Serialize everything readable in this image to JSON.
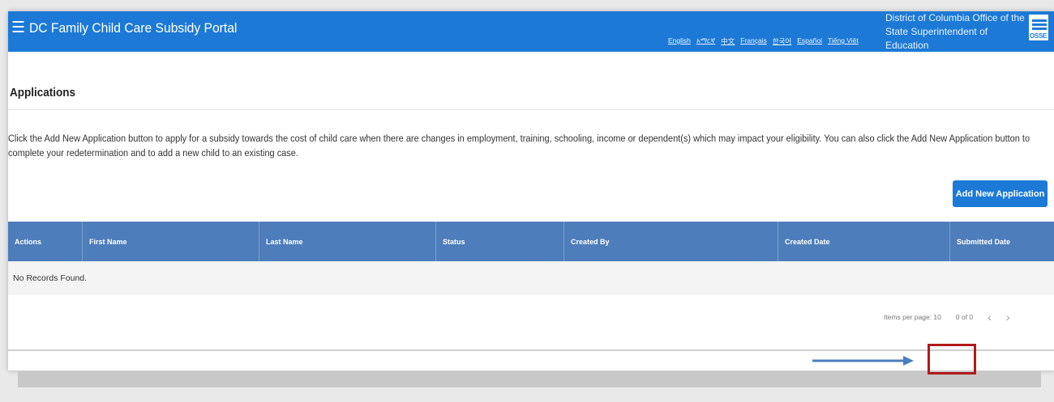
{
  "header": {
    "menu_icon": "hamburger-icon",
    "title": "DC Family Child Care Subsidy Portal",
    "languages": [
      "English",
      "አማርኛ",
      "中文",
      "Français",
      "한국어",
      "Español",
      "Tiếng Việt"
    ],
    "agency_line1": "District of Columbia Office of the",
    "agency_line2": "State Superintendent of Education",
    "logo_text": "OSSE",
    "color": "#1c7ad6"
  },
  "page": {
    "title": "Applications",
    "intro": "Click the Add New Application button to apply for a subsidy towards the cost of child care when there are changes in employment, training, schooling, income or dependent(s) which may impact your eligibility. You can also click the Add New Application button to complete your redetermination and to add a new child to an existing case.",
    "add_button": "Add New Application"
  },
  "table": {
    "columns": [
      "Actions",
      "First Name",
      "Last Name",
      "Status",
      "Created By",
      "Created Date",
      "Submitted Date"
    ],
    "empty_text": "No Records Found.",
    "header_color": "#4d7dba"
  },
  "pagination": {
    "items_per_page_label": "Items per page: 10",
    "range": "0 of 0",
    "prev_icon": "chevron-left-icon",
    "next_icon": "chevron-right-icon"
  },
  "annotation": {
    "arrow_color": "#4a7ec0",
    "box_color": "#b11a1a"
  }
}
